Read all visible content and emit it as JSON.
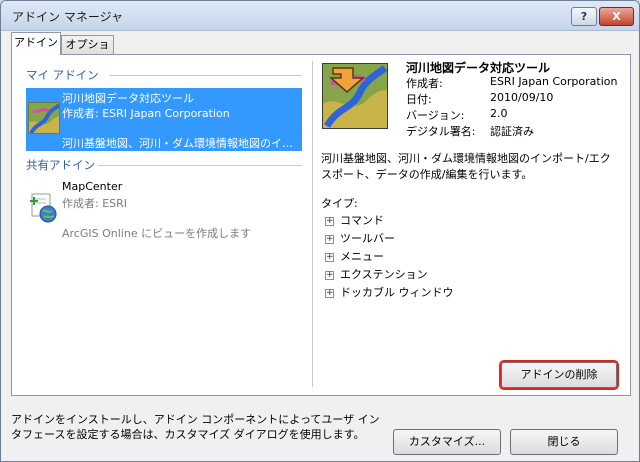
{
  "window": {
    "title": "アドイン マネージャ"
  },
  "titlebar": {
    "help_label": "?",
    "close_label": "X"
  },
  "tabs": [
    {
      "label": "アドイン"
    },
    {
      "label": "オプション"
    }
  ],
  "my_addins": {
    "heading": "マイ アドイン",
    "items": [
      {
        "name": "河川地図データ対応ツール",
        "author": "作成者: ESRI Japan Corporation",
        "description": "河川基盤地図、河川・ダム環境情報地図のイン…",
        "selected": true
      }
    ]
  },
  "shared_addins": {
    "heading": "共有アドイン",
    "items": [
      {
        "name": "MapCenter",
        "author": "作成者: ESRI",
        "description": "ArcGIS Online にビューを作成します"
      }
    ]
  },
  "details": {
    "title": "河川地図データ対応ツール",
    "fields": [
      {
        "label": "作成者:",
        "value": "ESRI Japan Corporation"
      },
      {
        "label": "日付:",
        "value": "2010/09/10"
      },
      {
        "label": "バージョン:",
        "value": "2.0"
      },
      {
        "label": "デジタル署名:",
        "value": "認証済み"
      }
    ],
    "description": "河川基盤地図、河川・ダム環境情報地図のインポート/エクスポート、データの作成/編集を行います。",
    "type_label": "タイプ:",
    "types": [
      {
        "expander": "+",
        "label": "コマンド"
      },
      {
        "expander": "+",
        "label": "ツールバー"
      },
      {
        "expander": "+",
        "label": "メニュー"
      },
      {
        "expander": "+",
        "label": "エクステンション"
      },
      {
        "expander": "+",
        "label": "ドッカブル ウィンドウ"
      }
    ],
    "remove_button": "アドインの削除"
  },
  "footer": {
    "text": "アドインをインストールし、アドイン コンポーネントによってユーザ インタフェースを設定する場合は、カスタマイズ ダイアログを使用します。",
    "customize_button": "カスタマイズ...",
    "close_button": "閉じる"
  },
  "colors": {
    "selection": "#3399ff",
    "section_heading": "#2f5ea6",
    "remove_highlight": "#e02222"
  }
}
